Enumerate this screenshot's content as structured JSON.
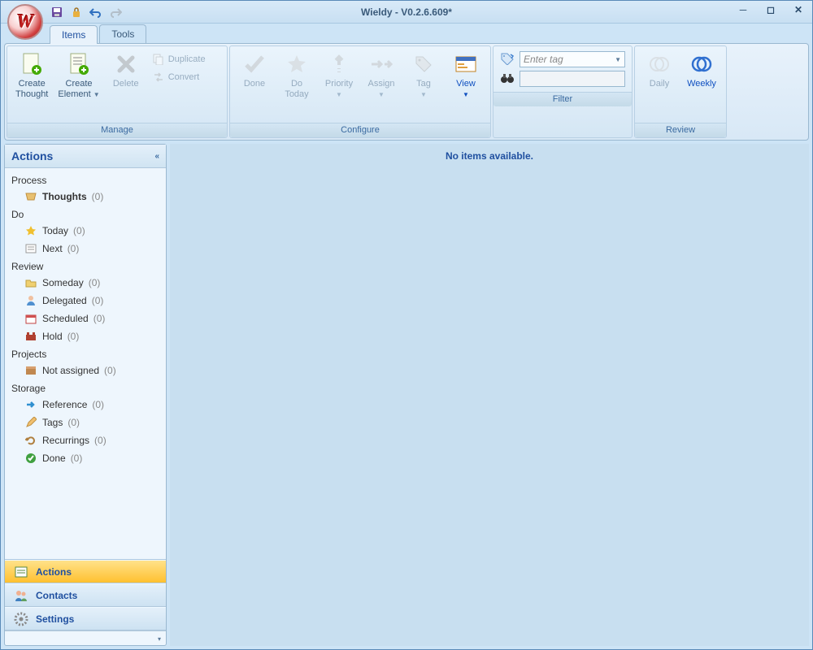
{
  "title": "Wieldy - V0.2.6.609*",
  "tabs": {
    "items": "Items",
    "tools": "Tools"
  },
  "ribbon": {
    "manage": {
      "label": "Manage",
      "create_thought": "Create\nThought",
      "create_element": "Create\nElement",
      "delete": "Delete",
      "duplicate": "Duplicate",
      "convert": "Convert"
    },
    "configure": {
      "label": "Configure",
      "done": "Done",
      "do_today": "Do\nToday",
      "priority": "Priority",
      "assign": "Assign",
      "tag": "Tag",
      "view": "View"
    },
    "filter": {
      "label": "Filter",
      "placeholder": "Enter tag"
    },
    "review": {
      "label": "Review",
      "daily": "Daily",
      "weekly": "Weekly"
    }
  },
  "sidebar": {
    "title": "Actions",
    "sections": {
      "process": "Process",
      "do": "Do",
      "review": "Review",
      "projects": "Projects",
      "storage": "Storage"
    },
    "items": {
      "thoughts": {
        "label": "Thoughts",
        "count": "(0)"
      },
      "today": {
        "label": "Today",
        "count": "(0)"
      },
      "next": {
        "label": "Next",
        "count": "(0)"
      },
      "someday": {
        "label": "Someday",
        "count": "(0)"
      },
      "delegated": {
        "label": "Delegated",
        "count": "(0)"
      },
      "scheduled": {
        "label": "Scheduled",
        "count": "(0)"
      },
      "hold": {
        "label": "Hold",
        "count": "(0)"
      },
      "not_assigned": {
        "label": "Not assigned",
        "count": "(0)"
      },
      "reference": {
        "label": "Reference",
        "count": "(0)"
      },
      "tags": {
        "label": "Tags",
        "count": "(0)"
      },
      "recurrings": {
        "label": "Recurrings",
        "count": "(0)"
      },
      "done": {
        "label": "Done",
        "count": "(0)"
      }
    },
    "nav": {
      "actions": "Actions",
      "contacts": "Contacts",
      "settings": "Settings"
    }
  },
  "main": {
    "empty": "No items available."
  }
}
